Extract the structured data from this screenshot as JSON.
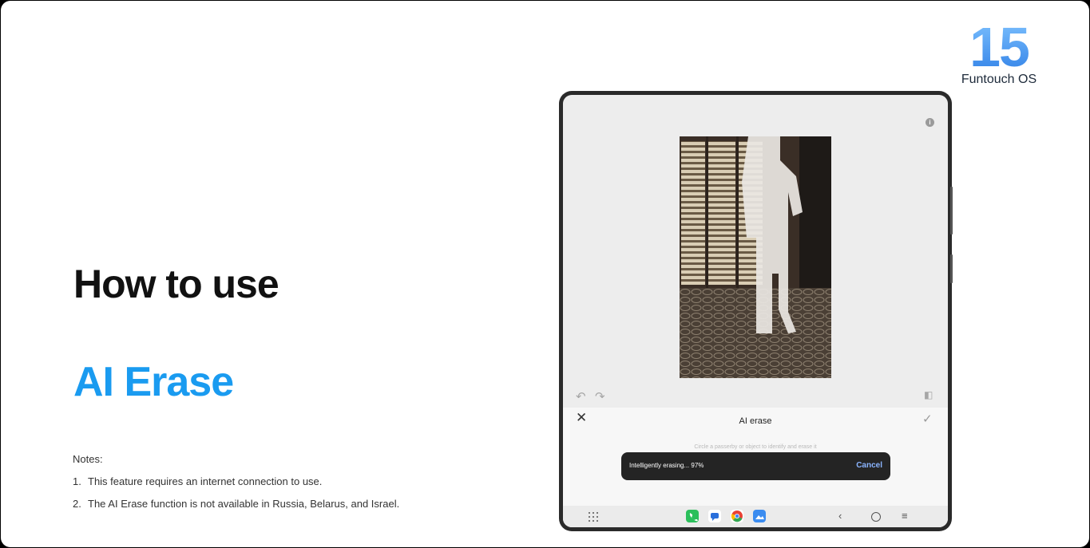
{
  "slide": {
    "title_main": "How to use",
    "title_feature": "AI Erase",
    "notes_heading": "Notes:",
    "notes": [
      {
        "num": "1.",
        "text": "This feature requires an internet connection to use."
      },
      {
        "num": "2.",
        "text": "The AI Erase function is not available in Russia, Belarus, and Israel."
      }
    ]
  },
  "brand": {
    "version": "15",
    "os_name": "Funtouch OS"
  },
  "device": {
    "editor": {
      "panel_title": "AI erase",
      "hint": "Circle a passerby or object to identify and erase it",
      "progress_text": "Intelligently erasing... 97%",
      "progress_percent": 97,
      "cancel_label": "Cancel",
      "icons": [
        "info-icon",
        "undo-icon",
        "redo-icon",
        "compare-icon",
        "close-icon",
        "check-icon"
      ]
    },
    "navbar": {
      "apps": [
        "phone-app-icon",
        "messages-app-icon",
        "chrome-app-icon",
        "gallery-app-icon"
      ],
      "icons": [
        "app-drawer-icon",
        "back-icon",
        "home-icon",
        "recents-icon"
      ]
    }
  },
  "colors": {
    "accent_blue": "#1a9bf0",
    "brand_gradient_top": "#7fc3ff",
    "brand_gradient_bottom": "#2f7fe6",
    "toast_bg": "#242424",
    "cancel_link": "#8ab4ff"
  }
}
